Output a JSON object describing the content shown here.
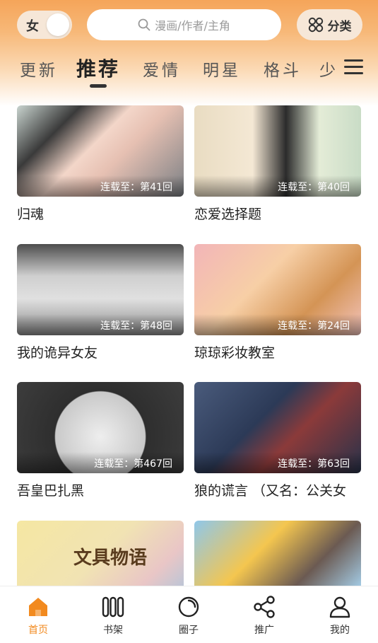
{
  "header": {
    "gender_toggle_label": "女",
    "search_placeholder": "漫画/作者/主角",
    "category_label": "分类"
  },
  "tabs": [
    {
      "label": "更新"
    },
    {
      "label": "推荐"
    },
    {
      "label": "爱情"
    },
    {
      "label": "明星"
    },
    {
      "label": "格斗"
    },
    {
      "label": "少"
    }
  ],
  "active_tab": "推荐",
  "comics": [
    {
      "title": "归魂",
      "progress": "连载至：第41回"
    },
    {
      "title": "恋爱选择题",
      "progress": "连载至：第40回"
    },
    {
      "title": "我的诡异女友",
      "progress": "连载至：第48回"
    },
    {
      "title": "琼琼彩妆教室",
      "progress": "连载至：第24回"
    },
    {
      "title": "吾皇巴扎黑",
      "progress": "连载至：第467回"
    },
    {
      "title": "狼的谎言 （又名：公关女",
      "progress": "连载至：第63回"
    },
    {
      "title": "文具物语",
      "progress": ""
    },
    {
      "title": "",
      "progress": ""
    }
  ],
  "bottom_nav": [
    {
      "label": "首页",
      "icon": "home-icon",
      "active": true
    },
    {
      "label": "书架",
      "icon": "bookshelf-icon",
      "active": false
    },
    {
      "label": "圈子",
      "icon": "circle-icon",
      "active": false
    },
    {
      "label": "推广",
      "icon": "share-icon",
      "active": false
    },
    {
      "label": "我的",
      "icon": "user-icon",
      "active": false
    }
  ],
  "colors": {
    "accent": "#f28a1f",
    "header_top": "#f5a55a"
  }
}
